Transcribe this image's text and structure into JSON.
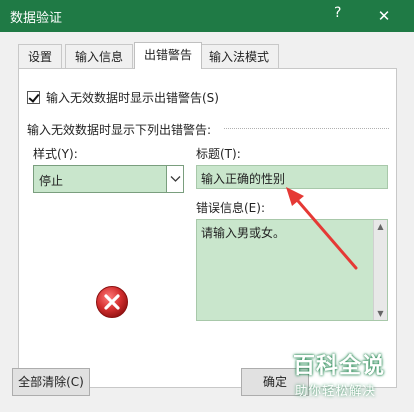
{
  "window": {
    "title": "数据验证",
    "help": "?",
    "close": "✕"
  },
  "tabs": [
    {
      "label": "设置"
    },
    {
      "label": "输入信息"
    },
    {
      "label": "出错警告"
    },
    {
      "label": "输入法模式"
    }
  ],
  "panel": {
    "show_alert_checkbox": "输入无效数据时显示出错警告(S)",
    "section_label": "输入无效数据时显示下列出错警告:",
    "style_label": "样式(Y):",
    "style_value": "停止",
    "title_label": "标题(T):",
    "title_value": "输入正确的性别",
    "message_label": "错误信息(E):",
    "message_value": "请输入男或女。"
  },
  "buttons": {
    "clear_all": "全部清除(C)",
    "ok": "确定"
  },
  "watermark": {
    "name": "百科全说",
    "slogan": "助你轻松解决"
  },
  "colors": {
    "titlebar": "#1f7a45",
    "highlight_fill": "#c9e6cc",
    "arrow": "#e53935",
    "error_icon": "#d32f2f"
  }
}
